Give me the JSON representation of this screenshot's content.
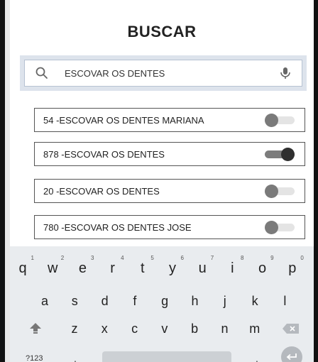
{
  "header": {
    "title": "BUSCAR"
  },
  "search": {
    "query": "ESCOVAR OS DENTES"
  },
  "items": [
    {
      "label": "54 -ESCOVAR OS DENTES MARIANA",
      "enabled": false
    },
    {
      "label": "878 -ESCOVAR OS DENTES",
      "enabled": true
    },
    {
      "label": "20 -ESCOVAR OS DENTES",
      "enabled": false
    },
    {
      "label": "780 -ESCOVAR OS DENTES JOSE",
      "enabled": false
    }
  ],
  "keyboard": {
    "row1": [
      {
        "key": "q",
        "num": "1"
      },
      {
        "key": "w",
        "num": "2"
      },
      {
        "key": "e",
        "num": "3"
      },
      {
        "key": "r",
        "num": "4"
      },
      {
        "key": "t",
        "num": "5"
      },
      {
        "key": "y",
        "num": "6"
      },
      {
        "key": "u",
        "num": "7"
      },
      {
        "key": "i",
        "num": "8"
      },
      {
        "key": "o",
        "num": "9"
      },
      {
        "key": "p",
        "num": "0"
      }
    ],
    "row2": [
      "a",
      "s",
      "d",
      "f",
      "g",
      "h",
      "j",
      "k",
      "l"
    ],
    "row3": [
      "z",
      "x",
      "c",
      "v",
      "b",
      "n",
      "m"
    ],
    "symbols_label": "?123",
    "comma": ",",
    "period": "."
  },
  "colors": {
    "search_bg": "#dde3ec",
    "keyboard_bg": "#e9ecef",
    "toggle_on": "#2f2f2f",
    "toggle_off": "#7a7a7a"
  },
  "icons": {
    "search": "magnifier-icon",
    "mic": "microphone-icon",
    "shift": "shift-icon",
    "backspace": "backspace-icon",
    "enter": "enter-icon"
  }
}
